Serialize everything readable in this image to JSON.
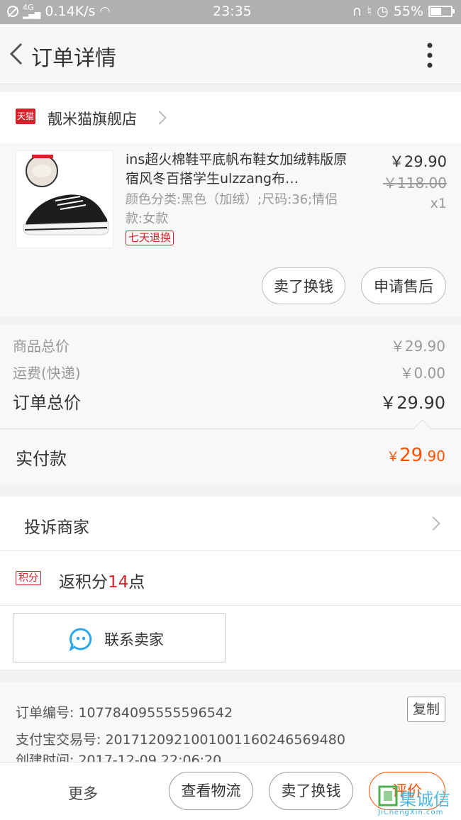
{
  "status_bar": {
    "network": "4G",
    "speed": "0.14K/s",
    "time": "23:35",
    "battery_text": "55%",
    "battery_level": 0.55
  },
  "header": {
    "title": "订单详情"
  },
  "store": {
    "badge": "天猫",
    "name": "靓米猫旗舰店"
  },
  "product": {
    "title": "ins超火棉鞋平底帆布鞋女加绒韩版原宿风冬百搭学生ulzzang布…",
    "spec": "颜色分类:黑色（加绒）;尺码:36;情侣款:女款",
    "tag": "七天退换",
    "price": "￥29.90",
    "original_price": "￥118.00",
    "quantity": "x1",
    "buttons": [
      "卖了换钱",
      "申请售后"
    ]
  },
  "summary": {
    "goods_label": "商品总价",
    "goods_value": "￥29.90",
    "shipping_label": "运费(快递)",
    "shipping_value": "￥0.00",
    "total_label": "订单总价",
    "total_value": "￥29.90"
  },
  "paid": {
    "label": "实付款",
    "currency": "￥",
    "integer": "29",
    "decimal": ".90"
  },
  "complain": {
    "label": "投诉商家"
  },
  "points": {
    "badge": "积分",
    "prefix": "返积分",
    "number": "14",
    "suffix": "点"
  },
  "contact": {
    "label": "联系卖家"
  },
  "info": {
    "order_no": "订单编号: 107784095555596542",
    "alipay_no": "支付宝交易号: 2017120921001001160246569480",
    "created": "创建时间: 2017-12-09 22:06:20",
    "copy_label": "复制"
  },
  "bottom_bar": {
    "more": "更多",
    "logistics": "查看物流",
    "sell": "卖了换钱",
    "review": "评价"
  },
  "watermark": {
    "text": "集诚信",
    "sub": "JiChengXin.com"
  },
  "colors": {
    "accent": "#ff5000",
    "tmall_red": "#d4222a",
    "contact_blue": "#2aa7e8"
  }
}
